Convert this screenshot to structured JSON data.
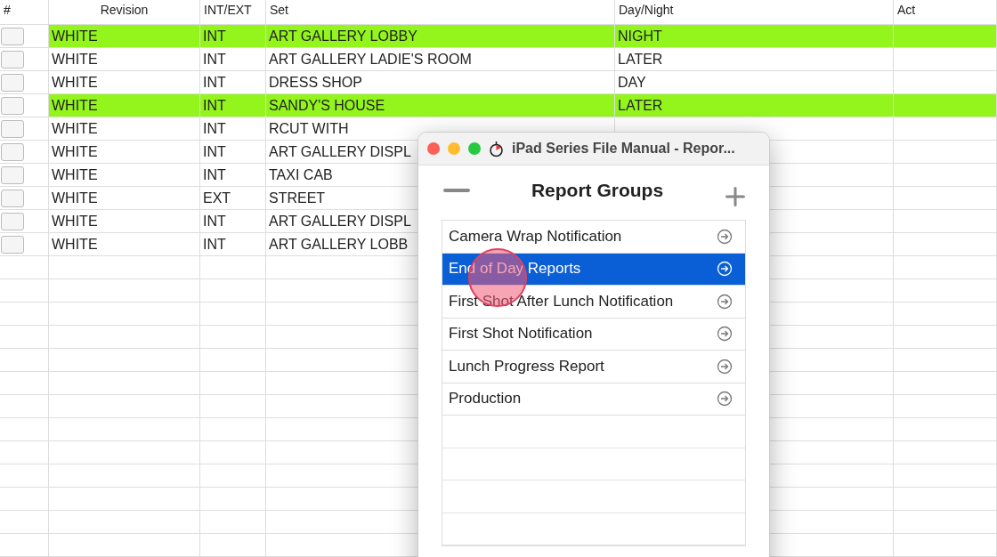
{
  "table": {
    "columns": [
      "#",
      "Revision",
      "INT/EXT",
      "Set",
      "Day/Night",
      "Act"
    ],
    "rows": [
      {
        "revision": "WHITE",
        "int_ext": "INT",
        "set": "ART GALLERY LOBBY",
        "day_night": "NIGHT",
        "highlighted": true
      },
      {
        "revision": "WHITE",
        "int_ext": "INT",
        "set": "ART GALLERY LADIE'S ROOM",
        "day_night": "LATER",
        "highlighted": false
      },
      {
        "revision": "WHITE",
        "int_ext": "INT",
        "set": "DRESS SHOP",
        "day_night": "DAY",
        "highlighted": false
      },
      {
        "revision": "WHITE",
        "int_ext": "INT",
        "set": "SANDY'S HOUSE",
        "day_night": "LATER",
        "highlighted": true
      },
      {
        "revision": "WHITE",
        "int_ext": "INT",
        "set": "RCUT WITH",
        "highlighted": false
      },
      {
        "revision": "WHITE",
        "int_ext": "INT",
        "set": "ART GALLERY DISPL",
        "highlighted": false
      },
      {
        "revision": "WHITE",
        "int_ext": "INT",
        "set": "TAXI CAB",
        "highlighted": false
      },
      {
        "revision": "WHITE",
        "int_ext": "EXT",
        "set": "STREET",
        "highlighted": false
      },
      {
        "revision": "WHITE",
        "int_ext": "INT",
        "set": "ART GALLERY DISPL",
        "highlighted": false
      },
      {
        "revision": "WHITE",
        "int_ext": "INT",
        "set": "ART GALLERY LOBB",
        "highlighted": false
      }
    ]
  },
  "window": {
    "title": "iPad Series File Manual - Repor...",
    "heading": "Report Groups",
    "items": [
      {
        "label": "Camera Wrap Notification",
        "selected": false
      },
      {
        "label": "End of Day Reports",
        "selected": true
      },
      {
        "label": "First Shot After Lunch Notification",
        "selected": false
      },
      {
        "label": "First Shot Notification",
        "selected": false
      },
      {
        "label": "Lunch Progress Report",
        "selected": false
      },
      {
        "label": "Production",
        "selected": false
      }
    ]
  }
}
